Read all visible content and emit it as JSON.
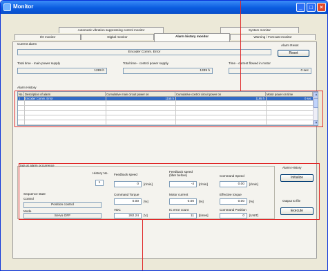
{
  "window": {
    "title": "Monitor",
    "controls": {
      "minimize": "_",
      "maximize": "□",
      "close": "×"
    }
  },
  "tabs": {
    "row_top": [
      {
        "label": "Automatic vibration suppressing control monitor"
      },
      {
        "label": "System monitor"
      }
    ],
    "row_bottom": [
      {
        "label": "I/O monitor"
      },
      {
        "label": "Digital monitor"
      },
      {
        "label": "Alarm history monitor",
        "active": true
      },
      {
        "label": "Warning / Forecast monitor"
      }
    ]
  },
  "current_alarm": {
    "label": "Current alarm",
    "value": "Encoder Comm. Error",
    "reset_label": "Alarm Reset",
    "reset_button": "Reset"
  },
  "times": {
    "main_label": "Total time - main power supply",
    "main_value": "1289 h",
    "control_label": "Total time - control power supply",
    "control_value": "1339 h",
    "motor_label": "Time - current flowed in motor",
    "motor_value": "0 sec"
  },
  "alarm_history": {
    "label": "Alarm History",
    "columns": [
      "No.",
      "Description of alarm",
      "Cumulative main circuit power on",
      "Cumulative control circuit power on",
      "Motor power on time"
    ],
    "rows": [
      {
        "no": "1",
        "description": "Encoder Comm. Error",
        "main": "1155 h",
        "control": "1195 h",
        "motor": "0 sec"
      }
    ]
  },
  "occurrence": {
    "label": "Data at alarm occurrence",
    "history_no_label": "History No.",
    "history_no_value": "1",
    "sequence_label": "Sequence state",
    "sequence_sub": "Control",
    "sequence_value": "Position control",
    "mode_label": "Mode",
    "mode_value": "Servo OFF",
    "metrics": [
      {
        "label": "Feedback speed",
        "value": "0",
        "unit": "[r/min]"
      },
      {
        "label": "Feedback speed\n(filter before)",
        "value": "-4",
        "unit": "[r/min]"
      },
      {
        "label": "Command Speed",
        "value": "0.00",
        "unit": "[r/min]"
      },
      {
        "label": "Command Torque",
        "value": "0.00",
        "unit": "[%]"
      },
      {
        "label": "Motor current",
        "value": "0.00",
        "unit": "[%]"
      },
      {
        "label": "Effective torque",
        "value": "0.00",
        "unit": "[%]"
      },
      {
        "label": "VDC",
        "value": "282.24",
        "unit": "[V]"
      },
      {
        "label": "IC error count",
        "value": "11",
        "unit": "[times]"
      },
      {
        "label": "Command Position",
        "value": "0",
        "unit": "[UNIT]"
      }
    ]
  },
  "side_actions": {
    "history_label": "Alarm History",
    "init_button": "Initialize",
    "output_label": "Output to file",
    "execute_button": "Execute"
  },
  "colors": {
    "title_bar": "#0a5ce0",
    "selection": "#316ac5",
    "annotation": "#e02a2a"
  }
}
